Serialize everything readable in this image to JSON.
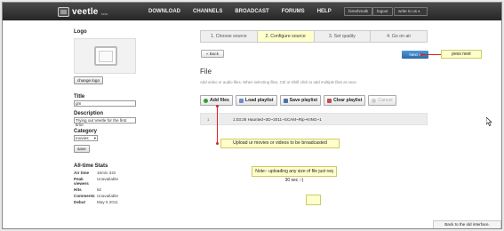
{
  "nav": {
    "logo_text": "veetle",
    "logo_beta": "beta",
    "links": [
      "DOWNLOAD",
      "CHANNELS",
      "BROADCAST",
      "FORUMS",
      "HELP"
    ],
    "username": "hireshmalk",
    "logout": "logout",
    "write_to_us": "write to us"
  },
  "sidebar": {
    "logo_heading": "Logo",
    "change_logo": "change logo",
    "title_heading": "Title",
    "title_value": "gm",
    "description_heading": "Description",
    "description_value": "Trying out Veetle for the first time",
    "category_heading": "Category",
    "category_value": "movies",
    "save_label": "save",
    "stats_heading": "All-time Stats",
    "stats": [
      {
        "k": "Air time",
        "v": "15min 32s"
      },
      {
        "k": "Peak viewers",
        "v": "Unavailable"
      },
      {
        "k": "Hits",
        "v": "82"
      },
      {
        "k": "Comments",
        "v": "Unavailable"
      },
      {
        "k": "Debut",
        "v": "May 5 2011"
      }
    ]
  },
  "steps": [
    "1. Choose source",
    "2. Configure source",
    "3. Set quality",
    "4. Go on air"
  ],
  "back_label": "« Back",
  "next_label": "Next »",
  "notes": {
    "press_next": "pess next",
    "upload": "Upload ur movies or videos to be broadcasted",
    "size": "Note:- uploading any size of file just req 30 sec :-)"
  },
  "file": {
    "title": "File",
    "hint": "Add video or audio files. When selecting files, Ctrl or Shift click to add multiple files at once.",
    "buttons": [
      "Add files",
      "Load playlist",
      "Save playlist",
      "Clear playlist",
      "Cancel"
    ],
    "row": {
      "num": "1",
      "name": "1:03:26  Haunted~3D~2011~SCAM~Rip~KING~1"
    }
  },
  "old_interface": "Back to the old interface.",
  "colors": {
    "accent": "#2b6aa8",
    "note": "#ffffcc",
    "marker": "#dd2222"
  }
}
